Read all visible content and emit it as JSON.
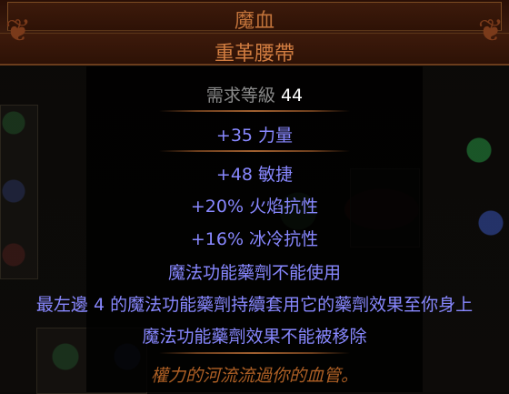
{
  "item": {
    "name": "魔血",
    "base_type": "重革腰帶",
    "requirement": {
      "label": "需求等級",
      "value": "44"
    },
    "implicit_mods": [
      "+35 力量"
    ],
    "explicit_mods": [
      "+48 敏捷",
      "+20% 火焰抗性",
      "+16% 冰冷抗性",
      "魔法功能藥劑不能使用",
      "最左邊 4 的魔法功能藥劑持續套用它的藥劑效果至你身上",
      "魔法功能藥劑效果不能被移除"
    ],
    "flavor_text": "權力的河流流過你的血管。"
  },
  "colors": {
    "unique_name": "#c0723a",
    "magic_mod": "#8888ff",
    "flavor": "#af6025",
    "requirement_label": "#8a8a8a"
  }
}
